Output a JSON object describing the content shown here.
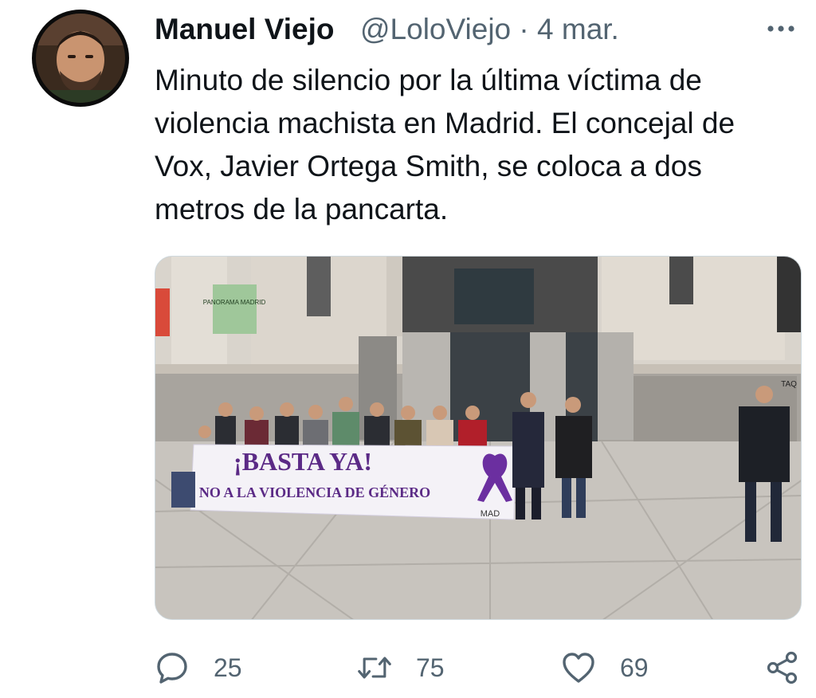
{
  "author": {
    "name": "Manuel Viejo",
    "handle": "@LoloViejo",
    "separator": "·",
    "date": "4 mar."
  },
  "tweet": {
    "text": "Minuto de silencio por la última víctima de violencia machista en Madrid. El concejal de Vox, Javier Ortega Smith, se coloca a dos metros de la pancarta."
  },
  "media": {
    "banner_line1": "¡BASTA YA!",
    "banner_line2": "NO A LA VIOLENCIA DE GÉNERO",
    "banner_logo": "MAD",
    "sign_left": "PANORAMA MADRID",
    "sign_right": "TAQ"
  },
  "actions": {
    "reply_count": "25",
    "retweet_count": "75",
    "like_count": "69"
  },
  "colors": {
    "text": "#0f1419",
    "secondary": "#536471",
    "banner_purple": "#5b2a86"
  },
  "icons": [
    "more-icon",
    "reply-icon",
    "retweet-icon",
    "like-icon",
    "share-icon"
  ]
}
